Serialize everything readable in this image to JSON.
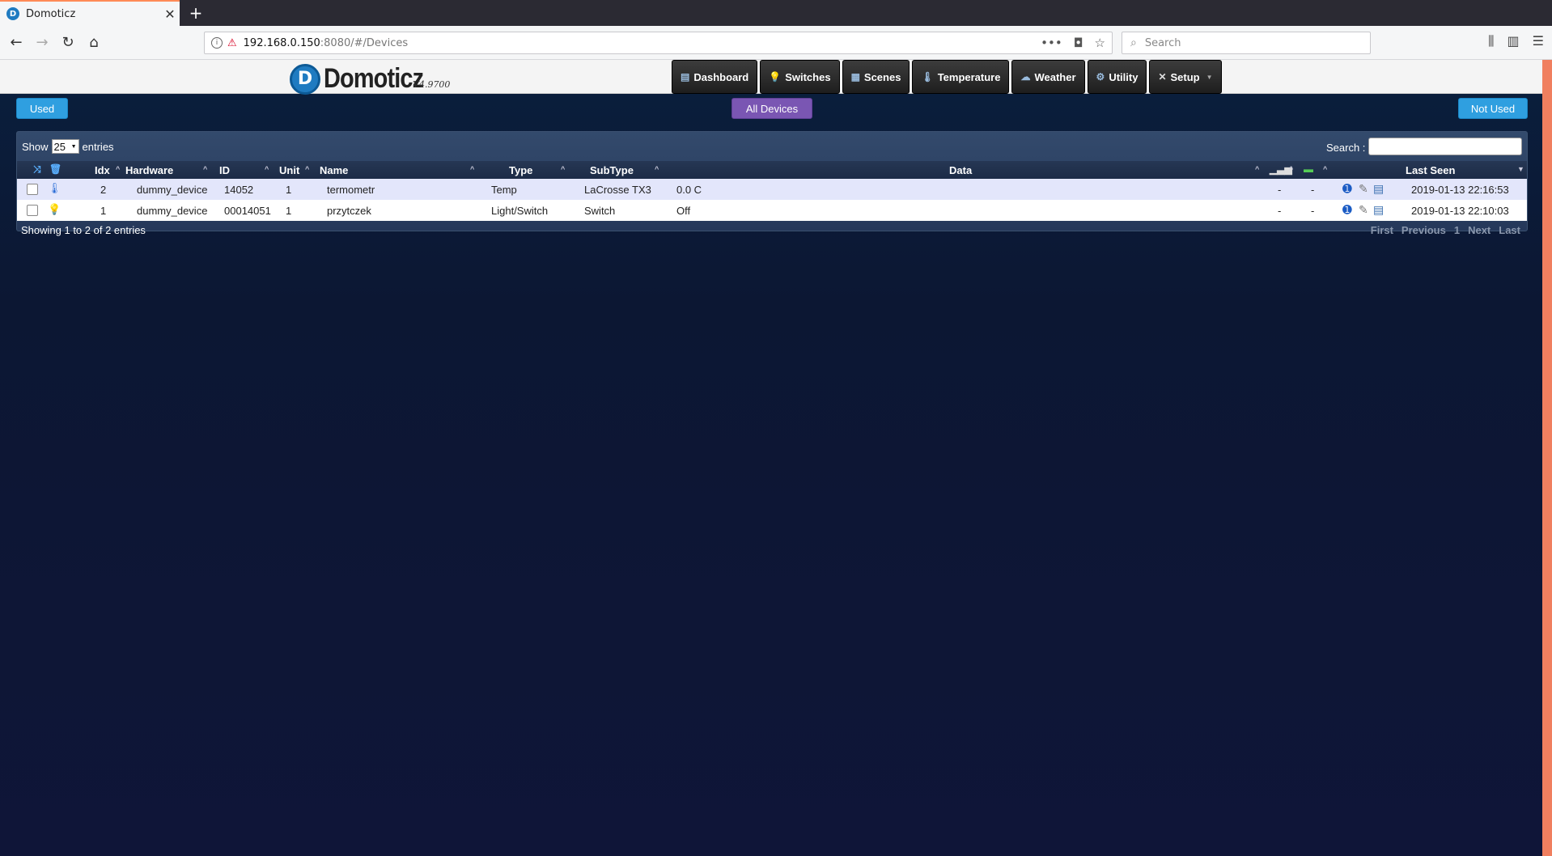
{
  "browser": {
    "tab_title": "Domoticz",
    "tab_favicon": "D",
    "url_host": "192.168.0.150",
    "url_rest": ":8080/#/Devices",
    "search_placeholder": "Search"
  },
  "app": {
    "logo_letter": "D",
    "logo_name": "Domoticz",
    "version": "V4.9700",
    "nav": [
      {
        "label": "Dashboard",
        "icon": "dashboard-icon"
      },
      {
        "label": "Switches",
        "icon": "bulb-icon"
      },
      {
        "label": "Scenes",
        "icon": "scenes-icon"
      },
      {
        "label": "Temperature",
        "icon": "thermometer-icon"
      },
      {
        "label": "Weather",
        "icon": "cloud-icon"
      },
      {
        "label": "Utility",
        "icon": "utility-icon"
      },
      {
        "label": "Setup",
        "icon": "tools-icon"
      }
    ],
    "filters": {
      "used": "Used",
      "all": "All Devices",
      "not_used": "Not Used"
    }
  },
  "table": {
    "show_label": "Show",
    "page_length": "25",
    "entries_label": "entries",
    "search_label": "Search :",
    "columns": {
      "idx": "Idx",
      "hardware": "Hardware",
      "id": "ID",
      "unit": "Unit",
      "name": "Name",
      "type": "Type",
      "subtype": "SubType",
      "data": "Data",
      "last_seen": "Last Seen"
    },
    "rows": [
      {
        "idx": "2",
        "hardware": "dummy_device",
        "id": "14052",
        "unit": "1",
        "name": "termometr",
        "type": "Temp",
        "subtype": "LaCrosse TX3",
        "data": "0.0 C",
        "signal": "-",
        "battery": "-",
        "last_seen": "2019-01-13 22:16:53",
        "icon": "thermometer-icon"
      },
      {
        "idx": "1",
        "hardware": "dummy_device",
        "id": "00014051",
        "unit": "1",
        "name": "przytczek",
        "type": "Light/Switch",
        "subtype": "Switch",
        "data": "Off",
        "signal": "-",
        "battery": "-",
        "last_seen": "2019-01-13 22:10:03",
        "icon": "bulb-icon"
      }
    ],
    "info": "Showing 1 to 2 of 2 entries",
    "pager": {
      "first": "First",
      "previous": "Previous",
      "page": "1",
      "next": "Next",
      "last": "Last"
    }
  }
}
